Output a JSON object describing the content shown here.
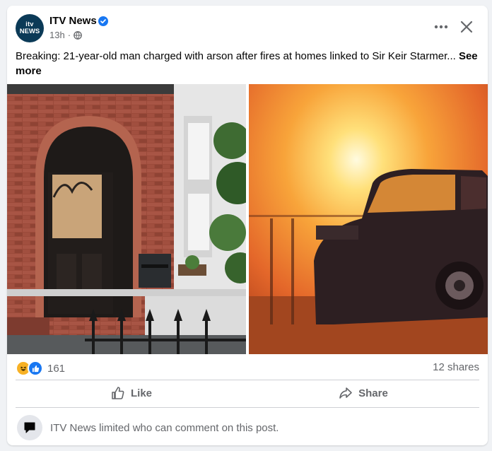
{
  "post": {
    "page_name": "ITV News",
    "avatar_text_top": "itv",
    "avatar_text_bottom": "NEWS",
    "time": "13h",
    "text": "Breaking: 21-year-old man charged with arson after fires at homes linked to Sir Keir Starmer...",
    "see_more": "See more"
  },
  "stats": {
    "reaction_count": "161",
    "shares": "12 shares"
  },
  "actions": {
    "like": "Like",
    "share": "Share"
  },
  "comments": {
    "notice": "ITV News limited who can comment on this post."
  },
  "icons": {
    "verified": "verified-badge-icon",
    "globe": "globe-icon",
    "more": "more-options-icon",
    "close": "close-icon",
    "haha": "haha-reaction-icon",
    "like_reaction": "like-reaction-icon",
    "like": "thumbs-up-icon",
    "share": "share-arrow-icon",
    "comment": "comment-bubble-icon"
  },
  "colors": {
    "accent": "#1877f2",
    "secondary_text": "#65676b",
    "background": "#f0f2f5"
  }
}
